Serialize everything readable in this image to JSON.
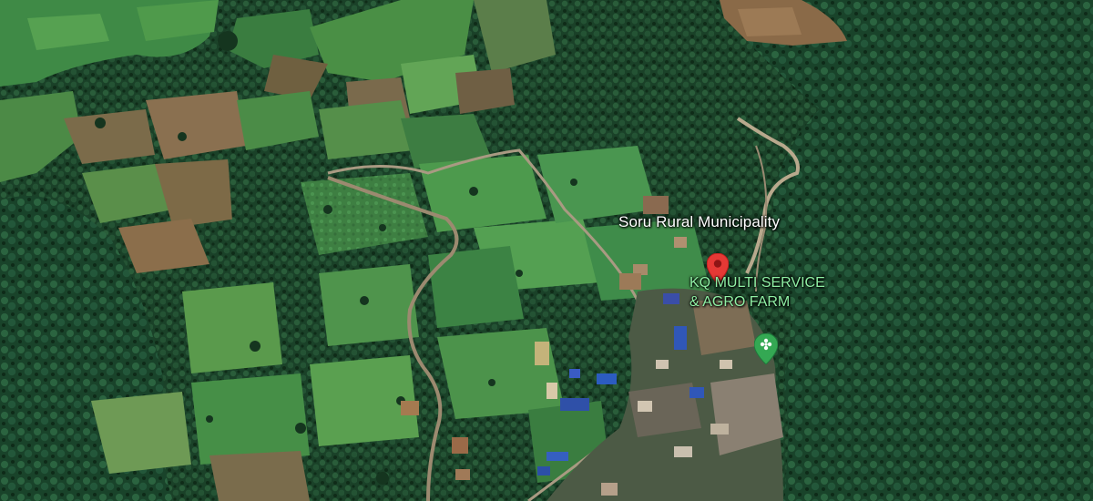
{
  "map": {
    "view": "satellite",
    "labels": {
      "place_name": "Soru Rural Municipality",
      "poi_name_line1": "KQ MULTI SERVICE",
      "poi_name_line2": "& AGRO FARM"
    },
    "markers": [
      {
        "type": "selected-place-pin",
        "color": "#e53935"
      },
      {
        "type": "poi-marker",
        "icon": "farm-icon",
        "color": "#34a853"
      }
    ],
    "colors": {
      "forest_dark": "#143420",
      "forest": "#21502f",
      "field_green": "#3f8a46",
      "field_light": "#5aa24e",
      "field_brown": "#8a6a48",
      "road": "#b5a48a",
      "roof_blue": "#3057b8",
      "label_white": "#ffffff",
      "label_poi": "#8ff0a4"
    }
  }
}
